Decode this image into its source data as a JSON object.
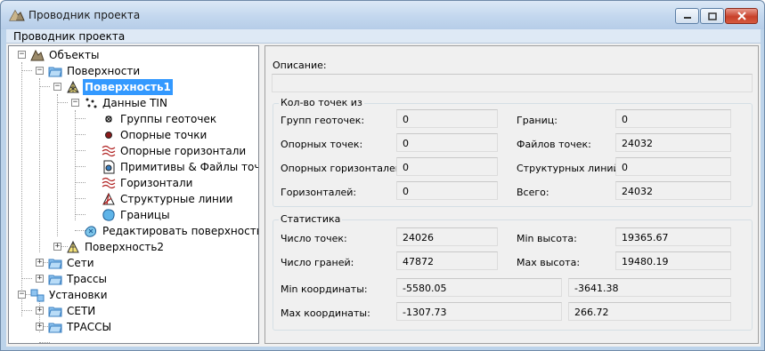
{
  "window": {
    "title": "Проводник проекта",
    "menu": [
      "Проводник проекта"
    ]
  },
  "tree": {
    "nodes": [
      {
        "label": "Объекты",
        "icon": "objects-icon",
        "expanded": true
      },
      {
        "label": "Поверхности",
        "icon": "folder-icon",
        "expanded": true
      },
      {
        "label": "Поверхность1",
        "icon": "surface-icon",
        "selected": true,
        "expanded": true
      },
      {
        "label": "Данные TIN",
        "icon": "tin-data-icon",
        "expanded": true
      },
      {
        "label": "Группы геоточек",
        "icon": "point-group-icon"
      },
      {
        "label": "Опорные точки",
        "icon": "control-point-icon"
      },
      {
        "label": "Опорные горизонтали",
        "icon": "contour-icon"
      },
      {
        "label": "Примитивы & Файлы точек",
        "icon": "point-file-icon"
      },
      {
        "label": "Горизонтали",
        "icon": "contour-icon"
      },
      {
        "label": "Структурные линии",
        "icon": "breakline-icon"
      },
      {
        "label": "Границы",
        "icon": "boundary-icon"
      },
      {
        "label": "Редактировать поверхность",
        "icon": "edit-surface-icon"
      },
      {
        "label": "Поверхность2",
        "icon": "surface-icon",
        "expanded": false
      },
      {
        "label": "Сети",
        "icon": "folder-icon",
        "expanded": false
      },
      {
        "label": "Трассы",
        "icon": "folder-icon",
        "expanded": false
      },
      {
        "label": "Установки",
        "icon": "settings-icon",
        "expanded": true
      },
      {
        "label": "СЕТИ",
        "icon": "folder-icon",
        "expanded": false
      },
      {
        "label": "ТРАССЫ",
        "icon": "folder-icon",
        "expanded": false
      }
    ]
  },
  "details": {
    "description_label": "Описание:",
    "description_value": "",
    "points_group": {
      "title": "Кол-во точек из",
      "rows": [
        {
          "l1": "Групп геоточек:",
          "v1": "0",
          "l2": "Границ:",
          "v2": "0"
        },
        {
          "l1": "Опорных точек:",
          "v1": "0",
          "l2": "Файлов точек:",
          "v2": "24032"
        },
        {
          "l1": "Опорных горизонталей:",
          "v1": "0",
          "l2": "Структурных линий",
          "v2": "0"
        },
        {
          "l1": "Горизонталей:",
          "v1": "0",
          "l2": "Всего:",
          "v2": "24032"
        }
      ]
    },
    "stats_group": {
      "title": "Статистика",
      "rows": [
        {
          "l1": "Число точек:",
          "v1": "24026",
          "l2": "Min высота:",
          "v2": "19365.67"
        },
        {
          "l1": "Число граней:",
          "v1": "47872",
          "l2": "Max высота:",
          "v2": "19480.19"
        }
      ],
      "coord_rows": [
        {
          "label": "Min координаты:",
          "x": "-5580.05",
          "y": "-3641.38"
        },
        {
          "label": "Max координаты:",
          "x": "-1307.73",
          "y": "266.72"
        }
      ]
    }
  }
}
